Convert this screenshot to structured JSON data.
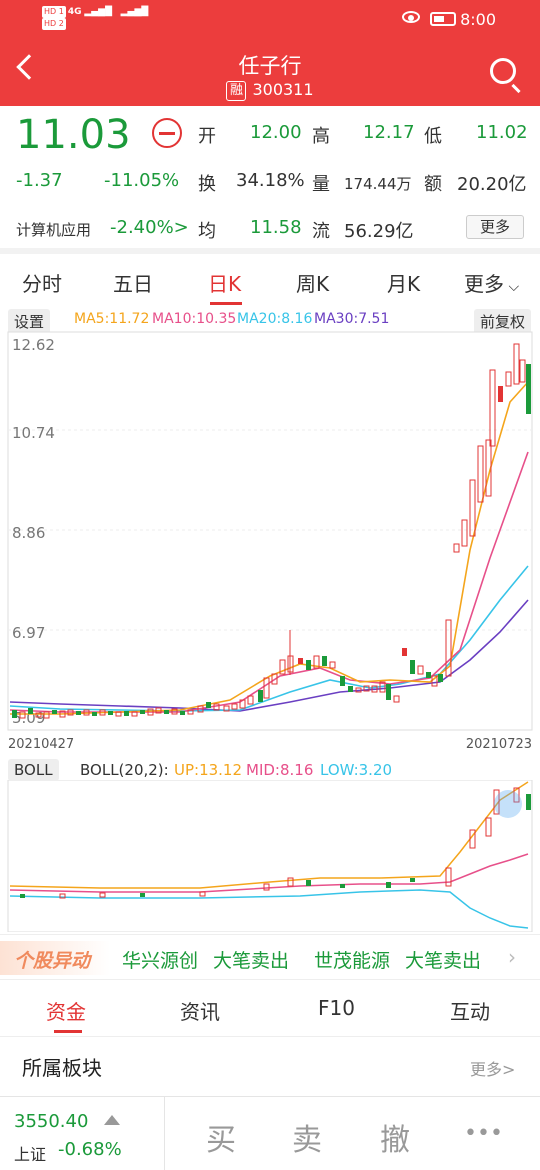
{
  "status": {
    "time": "8:00",
    "sim1": "HD 1",
    "sim2": "HD 2",
    "net": "4G"
  },
  "header": {
    "title": "任子行",
    "code": "300311",
    "rong_badge": "融"
  },
  "quote": {
    "price": "11.03",
    "change": "-1.37",
    "change_pct": "-11.05%",
    "open_label": "开",
    "open": "12.00",
    "high_label": "高",
    "high": "12.17",
    "low_label": "低",
    "low": "11.02",
    "turnover_label": "换",
    "turnover": "34.18%",
    "volume_label": "量",
    "volume": "174.44万",
    "amount_label": "额",
    "amount": "20.20亿",
    "sector": "计算机应用",
    "sector_pct": "-2.40%>",
    "avg_label": "均",
    "avg": "11.58",
    "float_label": "流",
    "float_cap": "56.29亿",
    "more": "更多"
  },
  "tabs": [
    {
      "label": "分时"
    },
    {
      "label": "五日"
    },
    {
      "label": "日K"
    },
    {
      "label": "周K"
    },
    {
      "label": "月K"
    },
    {
      "label": "更多"
    }
  ],
  "kline": {
    "settings": "设置",
    "ma5": "MA5:11.72",
    "ma10": "MA10:10.35",
    "ma20": "MA20:8.16",
    "ma30": "MA30:7.51",
    "adjust": "前复权",
    "y_ticks": [
      "12.62",
      "10.74",
      "8.86",
      "6.97",
      "5.09"
    ],
    "date_start": "20210427",
    "date_end": "20210723"
  },
  "boll": {
    "title": "BOLL",
    "param": "BOLL(20,2):",
    "up": "UP:13.12",
    "mid": "MID:8.16",
    "low": "LOW:3.20"
  },
  "ticker": {
    "label": "个股异动",
    "items": [
      "华兴源创",
      "大笔卖出",
      "世茂能源",
      "大笔卖出"
    ]
  },
  "subtabs": [
    {
      "label": "资金"
    },
    {
      "label": "资讯"
    },
    {
      "label": "F10"
    },
    {
      "label": "互动"
    }
  ],
  "sector_section": {
    "title": "所属板块",
    "more": "更多>"
  },
  "index": {
    "value": "3550.40",
    "name": "上证",
    "pct": "-0.68%"
  },
  "actions": {
    "buy": "买",
    "sell": "卖",
    "cancel": "撤",
    "more": "•••"
  },
  "colors": {
    "up": "#e23434",
    "down": "#1b9a3a",
    "ma5": "#f4a51c",
    "ma10": "#e7508a",
    "ma20": "#38c4e8",
    "ma30": "#6a3fc2"
  }
}
